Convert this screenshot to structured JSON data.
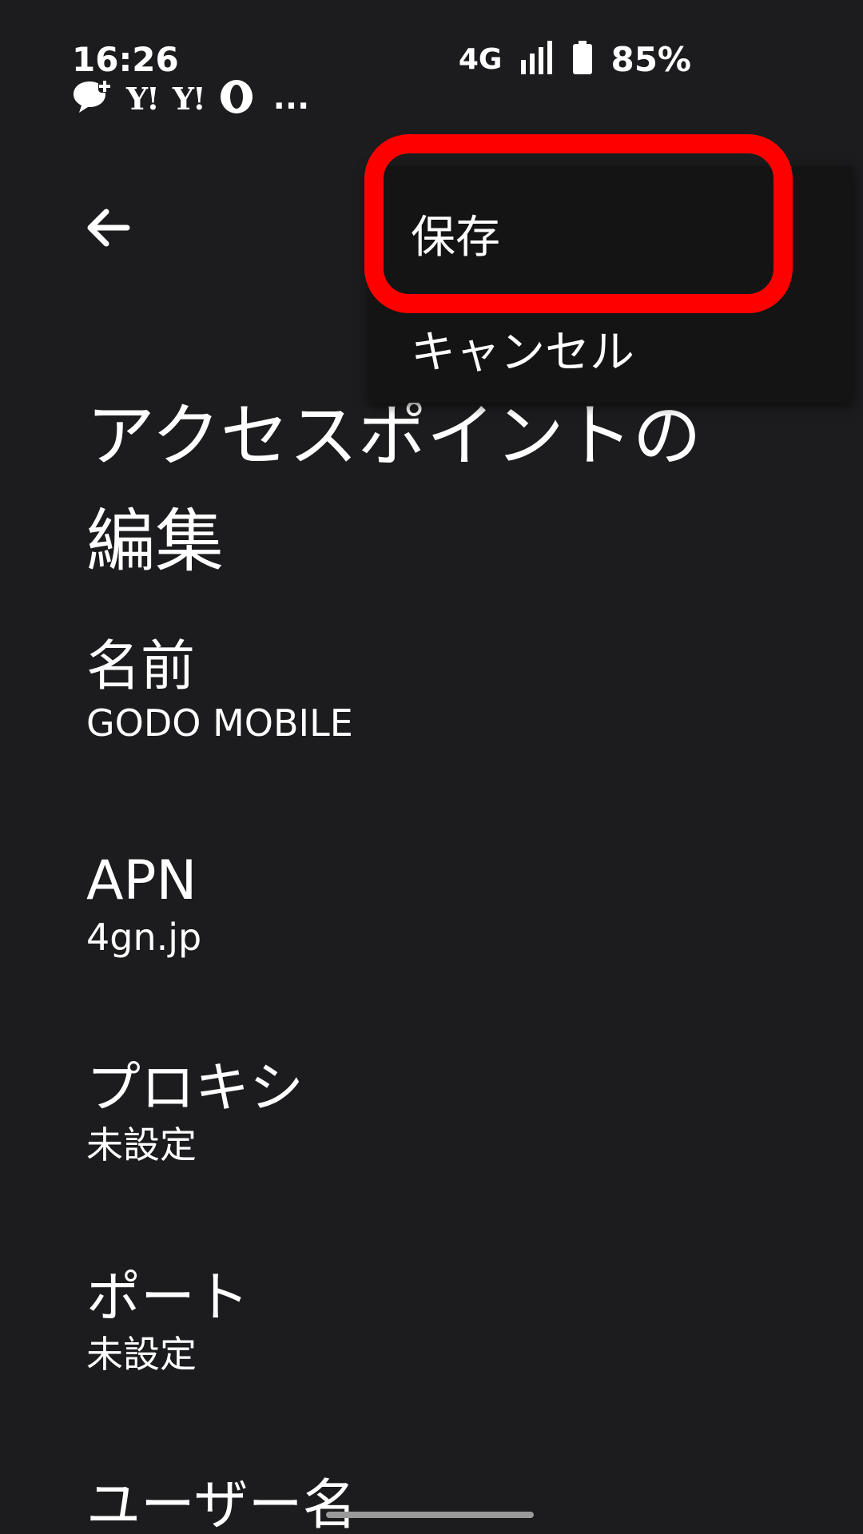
{
  "status_bar": {
    "time": "16:26",
    "network": "4G",
    "battery": "85%",
    "notification_icons": [
      "chat-plus-icon",
      "yahoo-icon",
      "yahoo-icon",
      "opera-icon"
    ],
    "yahoo_glyph": "Y!",
    "overflow": "..."
  },
  "menu": {
    "save": "保存",
    "cancel": "キャンセル"
  },
  "page": {
    "title": "アクセスポイントの編集"
  },
  "settings": [
    {
      "label": "名前",
      "value": "GODO MOBILE"
    },
    {
      "label": "APN",
      "value": "4gn.jp"
    },
    {
      "label": "プロキシ",
      "value": "未設定"
    },
    {
      "label": "ポート",
      "value": "未設定"
    },
    {
      "label": "ユーザー名"
    }
  ],
  "colors": {
    "background": "#1c1c1e",
    "menu_background": "#141414",
    "highlight": "#ff0000",
    "text": "#ffffff"
  }
}
